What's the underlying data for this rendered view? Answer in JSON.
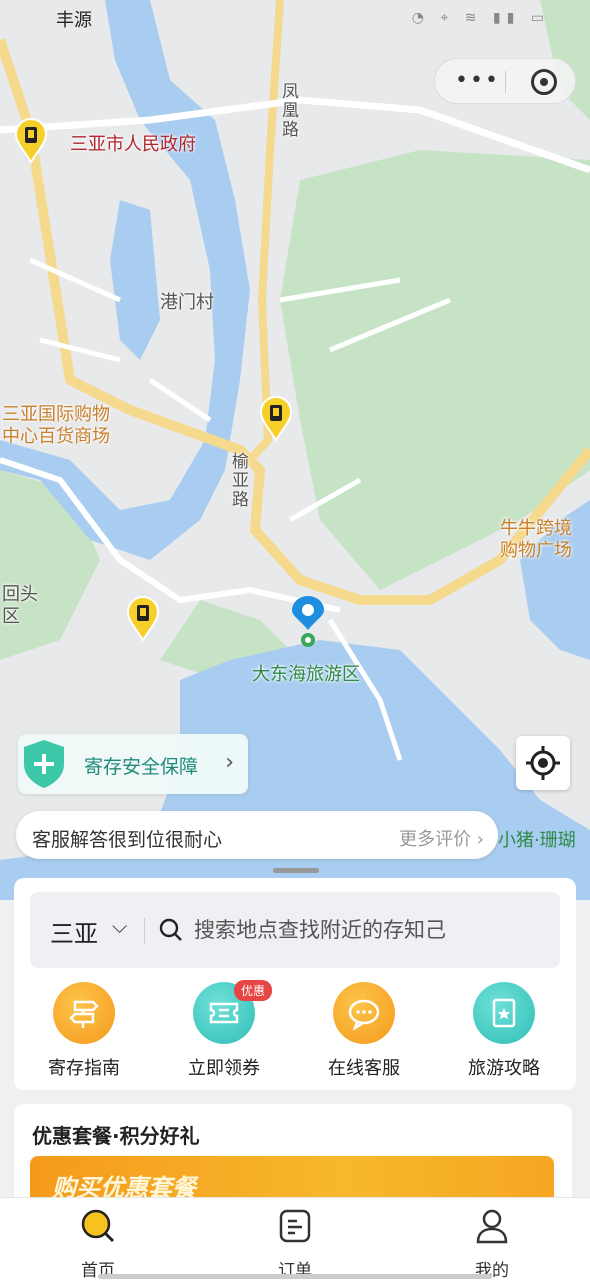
{
  "status_bar": {
    "carrier": "丰源"
  },
  "map": {
    "labels": {
      "gov": "三亚市人民政府",
      "village": "港门村",
      "road_fenghuang": "凤凰路",
      "road_yuya": "榆亚路",
      "mall_left": "三亚国际购物中心百货商场",
      "mall_right": "牛牛跨境购物广场",
      "huitou": "回头区",
      "destination": "大东海旅游区",
      "poi_right": "小猪·珊瑚"
    }
  },
  "safety_banner": {
    "label": "寄存安全保障"
  },
  "review_bar": {
    "text": "客服解答很到位很耐心",
    "more": "更多评价"
  },
  "search": {
    "city": "三亚",
    "placeholder": "搜索地点查找附近的存知己"
  },
  "quick_actions": [
    {
      "label": "寄存指南",
      "icon": "signpost-icon",
      "color": "#f6a22a"
    },
    {
      "label": "立即领券",
      "icon": "ticket-icon",
      "color": "#3cc8c0",
      "badge": "优惠"
    },
    {
      "label": "在线客服",
      "icon": "chat-icon",
      "color": "#f6a22a"
    },
    {
      "label": "旅游攻略",
      "icon": "guidebook-icon",
      "color": "#3cc8c0"
    }
  ],
  "promo": {
    "title": "优惠套餐·积分好礼",
    "banner_text": "购买优惠套餐"
  },
  "tabs": [
    {
      "label": "首页",
      "icon": "search-home-icon",
      "active": true
    },
    {
      "label": "订单",
      "icon": "order-icon",
      "active": false
    },
    {
      "label": "我的",
      "icon": "user-icon",
      "active": false
    }
  ],
  "colors": {
    "accent": "#f6b51e",
    "teal": "#3cc8c0",
    "water": "#a9cdf0"
  }
}
